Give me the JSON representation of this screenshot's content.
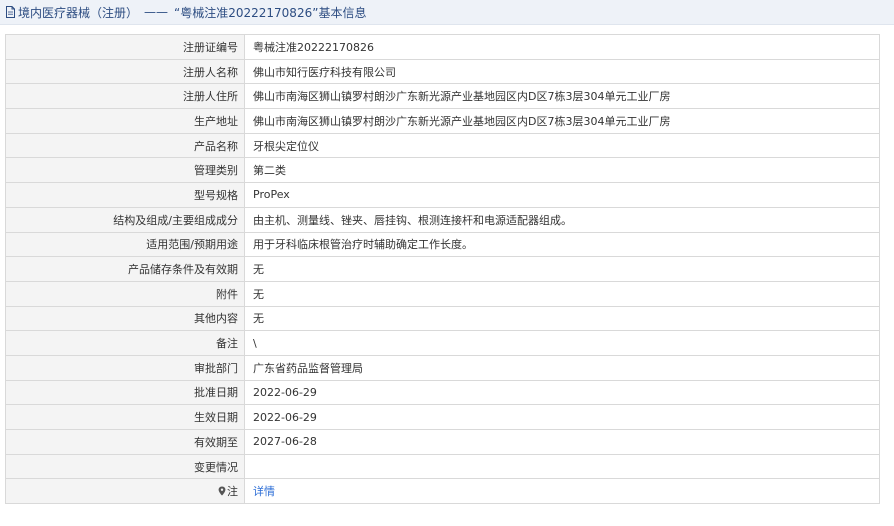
{
  "header": {
    "category": "境内医疗器械（注册）",
    "separator": "——",
    "quoted_id": "“粤械注准20222170826”",
    "suffix": "基本信息"
  },
  "rows": [
    {
      "label": "注册证编号",
      "value": "粤械注准20222170826"
    },
    {
      "label": "注册人名称",
      "value": "佛山市知行医疗科技有限公司"
    },
    {
      "label": "注册人住所",
      "value": "佛山市南海区狮山镇罗村朗沙广东新光源产业基地园区内D区7栋3层304单元工业厂房"
    },
    {
      "label": "生产地址",
      "value": "佛山市南海区狮山镇罗村朗沙广东新光源产业基地园区内D区7栋3层304单元工业厂房"
    },
    {
      "label": "产品名称",
      "value": "牙根尖定位仪"
    },
    {
      "label": "管理类别",
      "value": "第二类"
    },
    {
      "label": "型号规格",
      "value": "ProPex"
    },
    {
      "label": "结构及组成/主要组成成分",
      "value": "由主机、测量线、锉夹、唇挂钩、根测连接杆和电源适配器组成。"
    },
    {
      "label": "适用范围/预期用途",
      "value": "用于牙科临床根管治疗时辅助确定工作长度。"
    },
    {
      "label": "产品储存条件及有效期",
      "value": "无"
    },
    {
      "label": "附件",
      "value": "无"
    },
    {
      "label": "其他内容",
      "value": "无"
    },
    {
      "label": "备注",
      "value": "\\"
    },
    {
      "label": "审批部门",
      "value": "广东省药品监督管理局"
    },
    {
      "label": "批准日期",
      "value": "2022-06-29"
    },
    {
      "label": "生效日期",
      "value": "2022-06-29"
    },
    {
      "label": "有效期至",
      "value": "2027-06-28"
    },
    {
      "label": "变更情况",
      "value": ""
    }
  ],
  "note_row": {
    "label": "注",
    "link_text": "详情",
    "icon": "pin-icon"
  },
  "colors": {
    "link": "#2a6cd6",
    "title": "#2d4d82",
    "label_bg": "#f4f4f4"
  }
}
